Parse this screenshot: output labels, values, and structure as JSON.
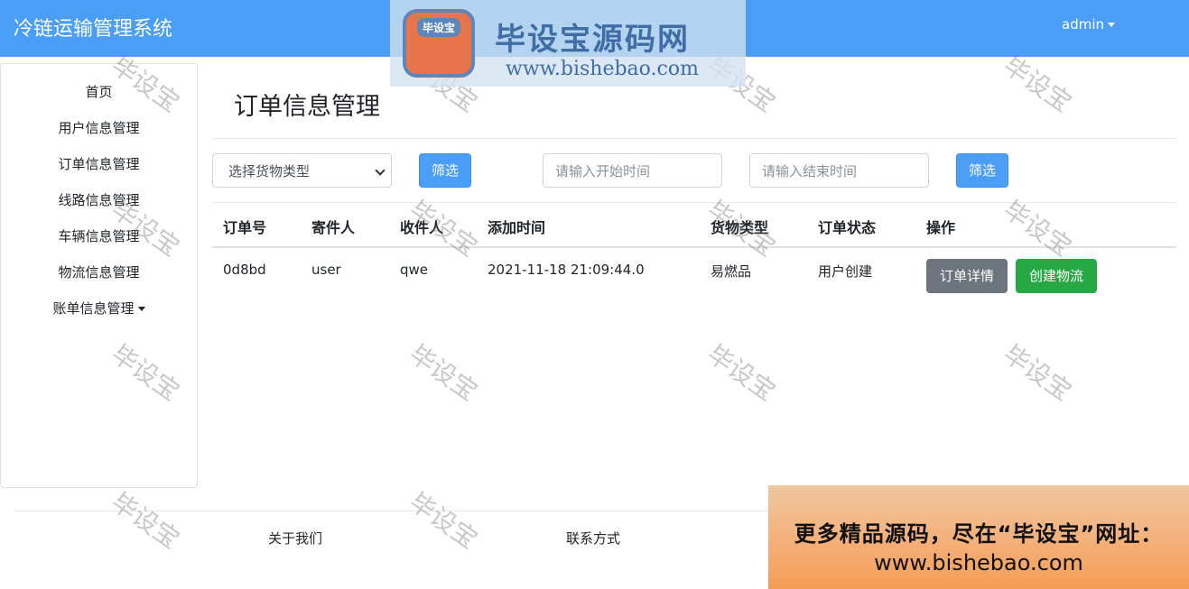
{
  "header": {
    "brand": "冷链运输管理系统",
    "user_menu": "admin"
  },
  "logo_banner": {
    "mark_text": "毕设宝",
    "title": "毕设宝源码网",
    "url": "www.bishebao.com"
  },
  "sidebar": {
    "items": [
      {
        "label": "首页"
      },
      {
        "label": "用户信息管理"
      },
      {
        "label": "订单信息管理"
      },
      {
        "label": "线路信息管理"
      },
      {
        "label": "车辆信息管理"
      },
      {
        "label": "物流信息管理"
      },
      {
        "label": "账单信息管理"
      }
    ]
  },
  "main": {
    "title": "订单信息管理",
    "filters": {
      "cargo_select": "选择货物类型",
      "filter_button_1": "筛选",
      "start_time_placeholder": "请输入开始时间",
      "end_time_placeholder": "请输入结束时间",
      "filter_button_2": "筛选"
    },
    "table": {
      "headers": [
        "订单号",
        "寄件人",
        "收件人",
        "添加时间",
        "货物类型",
        "订单状态",
        "操作"
      ],
      "rows": [
        {
          "order_id": "0d8bd",
          "sender": "user",
          "receiver": "qwe",
          "added_time": "2021-11-18 21:09:44.0",
          "cargo_type": "易燃品",
          "status": "用户创建",
          "detail_button": "订单详情",
          "create_logistics_button": "创建物流"
        }
      ]
    }
  },
  "footer": {
    "about": "关于我们",
    "contact": "联系方式"
  },
  "watermark_text": "毕设宝",
  "ad_banner": {
    "line1": "更多精品源码，尽在“毕设宝”网址：",
    "line2": "www.bishebao.com"
  }
}
